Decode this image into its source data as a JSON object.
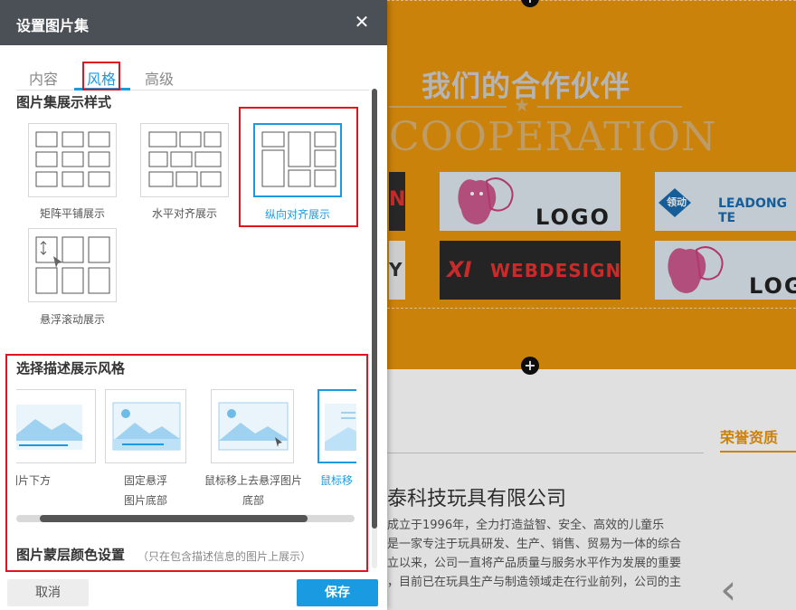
{
  "background": {
    "partners_title": "我们的合作伙伴",
    "partners_subtitle": "COOPERATION",
    "logo_fragment_1": "N",
    "logo_fragment_2": "Y",
    "logo_a_text": "LOGO",
    "logo_b_text": "LEADONG TE",
    "logo_b_mark": "领动",
    "logo_c_mark": "XI",
    "logo_c_text": "WEBDESIGN",
    "logo_d_text": "LOG",
    "honor_label": "荣誉资质",
    "company_name": "泰科技玩具有限公司",
    "company_desc_line1": "成立于1996年，全力打造益智、安全、高效的儿童乐",
    "company_desc_line2": "是一家专注于玩具研发、生产、销售、贸易为一体的综合",
    "company_desc_line3": "立以来，公司一直将产品质量与服务水平作为发展的重要",
    "company_desc_line4": "，目前已在玩具生产与制造领域走在行业前列，公司的主",
    "carousel_prev": "‹",
    "plus": "+"
  },
  "dialog": {
    "title": "设置图片集",
    "close": "✕",
    "tabs": [
      {
        "label": "内容"
      },
      {
        "label": "风格",
        "active": true
      },
      {
        "label": "高级"
      }
    ],
    "display_section_title": "图片集展示样式",
    "display_options": [
      {
        "label": "矩阵平铺展示"
      },
      {
        "label": "水平对齐展示"
      },
      {
        "label": "纵向对齐展示",
        "selected": true
      },
      {
        "label": "悬浮滚动展示"
      }
    ],
    "desc_section_title": "选择描述展示风格",
    "desc_options": [
      {
        "label": "图片下方"
      },
      {
        "label_line1": "固定悬浮",
        "label_line2": "图片底部"
      },
      {
        "label_line1": "鼠标移上去悬浮图片",
        "label_line2": "底部"
      },
      {
        "label": "鼠标移",
        "selected": true
      }
    ],
    "mask_section_title": "图片蒙层颜色设置",
    "mask_section_note": "（只在包含描述信息的图片上展示）",
    "cancel_label": "取消",
    "save_label": "保存"
  },
  "colors": {
    "accent": "#1a9ae0",
    "highlight": "#e1141d",
    "header": "#4b4f56",
    "site_orange": "#e8940c"
  }
}
